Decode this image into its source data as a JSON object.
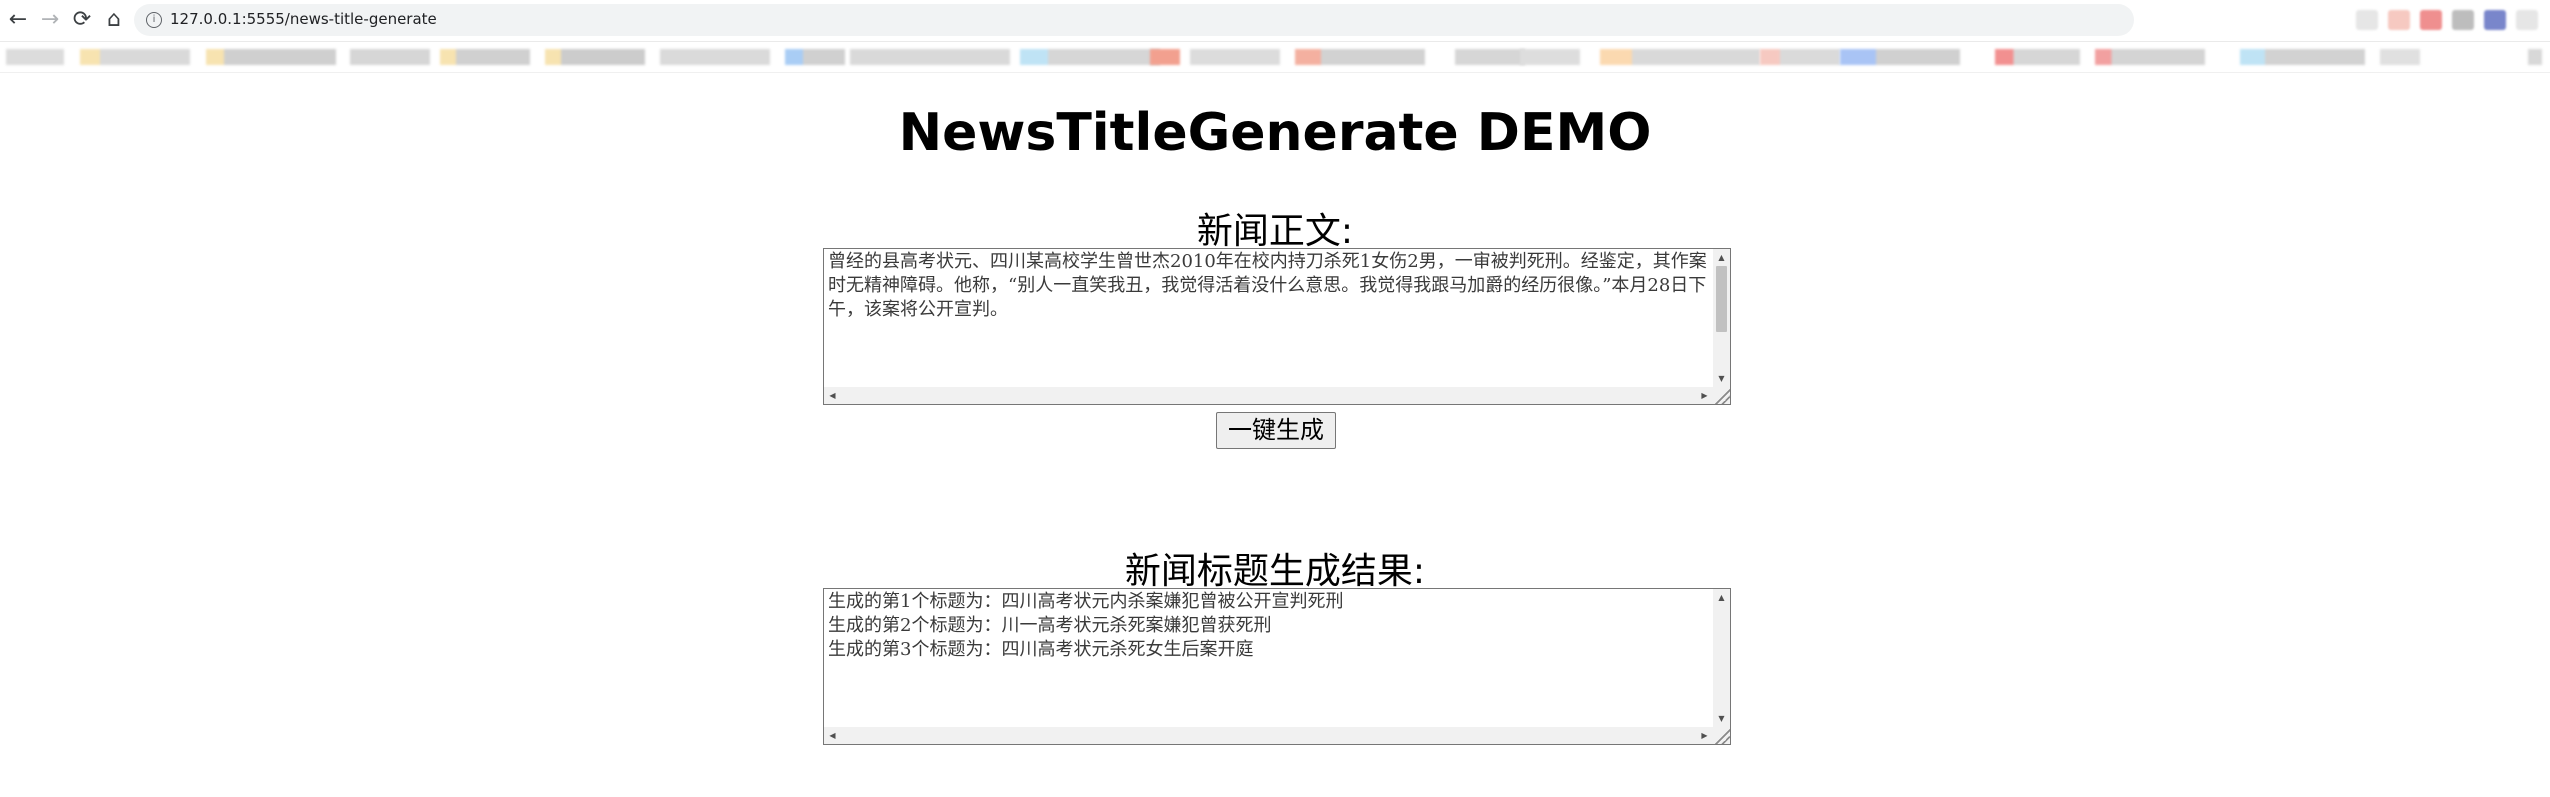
{
  "browser": {
    "url": "127.0.0.1:5555/news-title-generate",
    "nav": {
      "back": "←",
      "forward": "→",
      "reload": "⟳",
      "home": "⌂",
      "info": "i"
    }
  },
  "page": {
    "title": "NewsTitleGenerate DEMO",
    "input_label": "新闻正文:",
    "input_text": "曾经的县高考状元、四川某高校学生曾世杰2010年在校内持刀杀死1女伤2男，一审被判死刑。经鉴定，其作案时无精神障碍。他称，“别人一直笑我丑，我觉得活着没什么意思。我觉得我跟马加爵的经历很像。”本月28日下午，该案将公开宣判。",
    "button_label": "一键生成",
    "output_label": "新闻标题生成结果:",
    "output_text": "生成的第1个标题为：四川高考状元内杀案嫌犯曾被公开宣判死刑\n生成的第2个标题为：川一高考状元杀死案嫌犯曾获死刑\n生成的第3个标题为：四川高考状元杀死女生后案开庭"
  }
}
